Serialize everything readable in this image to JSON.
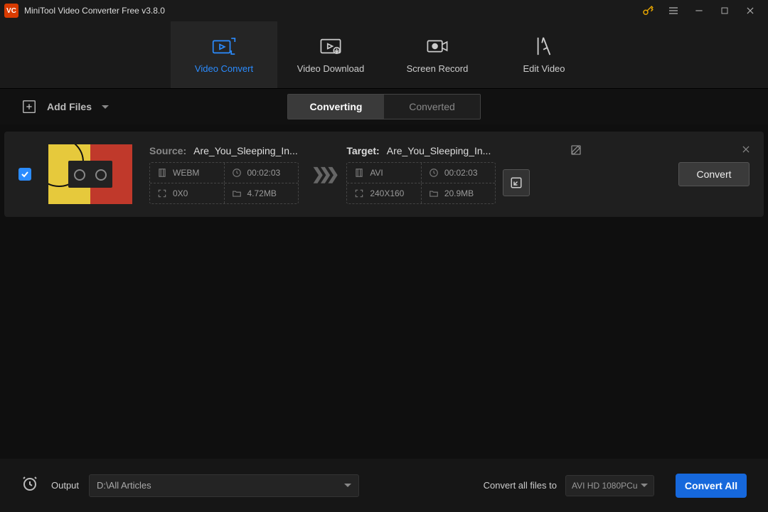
{
  "app": {
    "title": "MiniTool Video Converter Free v3.8.0"
  },
  "tabs": {
    "convert": "Video Convert",
    "download": "Video Download",
    "record": "Screen Record",
    "edit": "Edit Video"
  },
  "toolbar": {
    "add_files": "Add Files"
  },
  "seg": {
    "converting": "Converting",
    "converted": "Converted"
  },
  "item": {
    "source_label": "Source:",
    "source_name": "Are_You_Sleeping_In...",
    "source": {
      "format": "WEBM",
      "duration": "00:02:03",
      "dimensions": "0X0",
      "size": "4.72MB"
    },
    "target_label": "Target:",
    "target_name": "Are_You_Sleeping_In...",
    "target": {
      "format": "AVI",
      "duration": "00:02:03",
      "dimensions": "240X160",
      "size": "20.9MB"
    },
    "convert_btn": "Convert"
  },
  "bottom": {
    "output_label": "Output",
    "output_path": "D:\\All Articles",
    "convert_all_to": "Convert all files to",
    "format": "AVI HD 1080PCu",
    "convert_all": "Convert All"
  }
}
